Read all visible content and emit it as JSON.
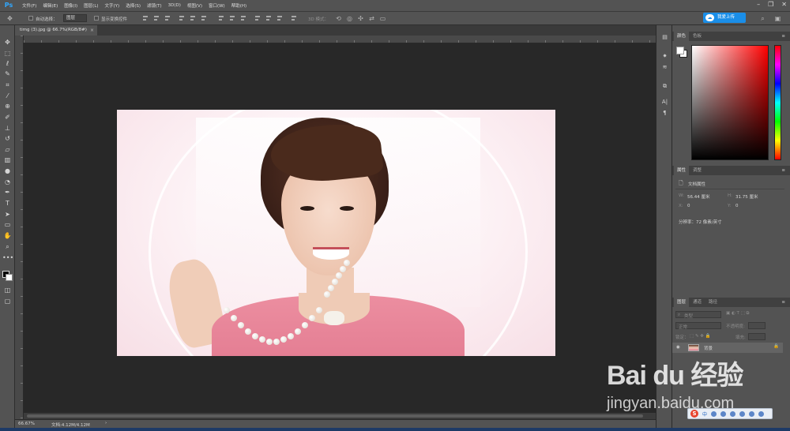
{
  "app": {
    "logo": "Ps",
    "menu": [
      "文件(F)",
      "编辑(E)",
      "图像(I)",
      "图层(L)",
      "文字(Y)",
      "选择(S)",
      "滤镜(T)",
      "3D(D)",
      "视图(V)",
      "窗口(W)",
      "帮助(H)"
    ],
    "window_controls": [
      "minimize-icon",
      "restore-icon",
      "close-icon"
    ]
  },
  "options": {
    "auto_select_label": "自动选择：",
    "auto_select_value": "图层",
    "show_transform_label": "显示变换控件",
    "mode_3d_label": "3D 模式：",
    "upload_button": "我爱上传"
  },
  "document": {
    "tab_title": "timg (3).jpg @ 66.7%(RGB/8#)",
    "zoom": "66.67%",
    "doc_info": "文档:4.12M/4.12M"
  },
  "panels": {
    "color_tabs": [
      "颜色",
      "色板"
    ],
    "props_tabs": [
      "属性",
      "调整"
    ],
    "props": {
      "doc_props_label": "文档属性",
      "w_label": "W:",
      "w_value": "56.44 厘米",
      "h_label": "H:",
      "h_value": "31.75 厘米",
      "x_label": "X:",
      "x_value": "0",
      "y_label": "Y:",
      "y_value": "0",
      "resolution": "分辨率：72 像素/英寸"
    },
    "layers_tabs": [
      "图层",
      "通道",
      "路径"
    ],
    "layers": {
      "kind_label": "类型",
      "blend_mode": "正常",
      "opacity_label": "不透明度:",
      "lock_label": "锁定：",
      "fill_label": "填充:",
      "rows": [
        {
          "name": "背景"
        }
      ]
    }
  },
  "watermark": {
    "brand": "Bai du 经验",
    "url": "jingyan.baidu.com"
  },
  "ime": {
    "lang": "中"
  },
  "colors": {
    "accent": "#31a8ff",
    "upload_button": "#1a8ee8",
    "panel_bg": "#535353",
    "pasteboard": "#282828"
  }
}
